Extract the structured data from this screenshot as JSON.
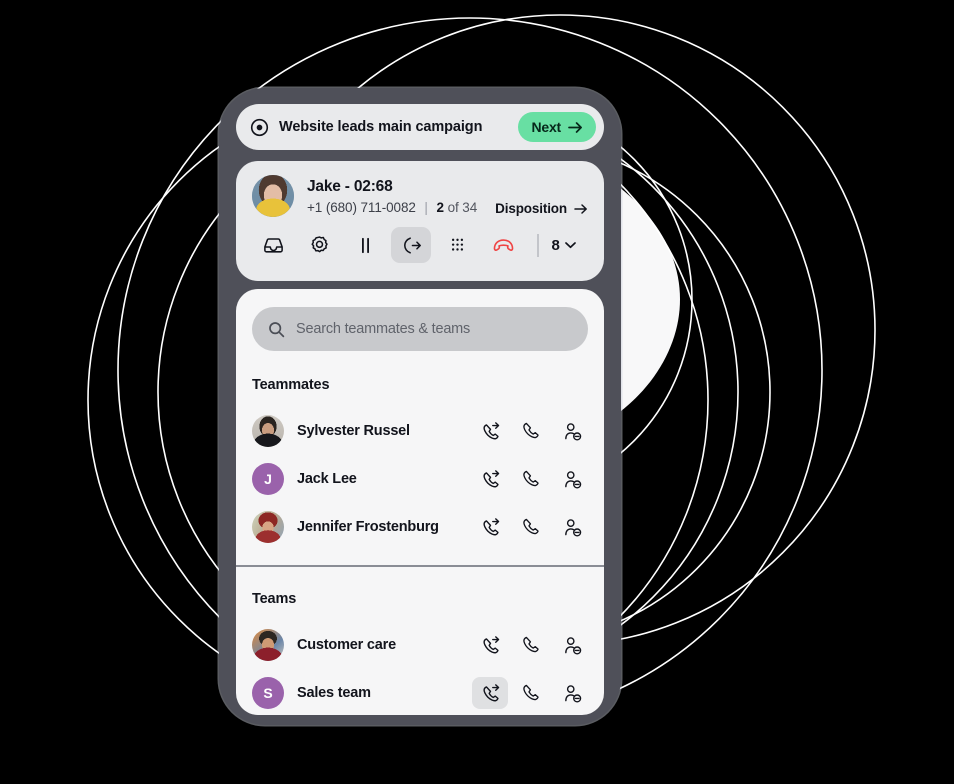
{
  "colors": {
    "background": "#000000",
    "phone_frame": "#4f5059",
    "card_surface": "#e9eaec",
    "panel_surface": "#f6f6f7",
    "accent_green": "#68dfa3",
    "hangup_red": "#ef4444",
    "avatar_purple": "#9a62ab",
    "search_field": "#c8c9cc",
    "text_primary": "#12141c",
    "decor_line": "#ffffff"
  },
  "campaign_bar": {
    "icon": "target-record-icon",
    "title": "Website leads main campaign",
    "next_label": "Next",
    "next_icon": "arrow-right-icon"
  },
  "call_card": {
    "avatar": "contact-photo",
    "contact_name": "Jake",
    "separator": "-",
    "duration": "02:68",
    "phone_number": "+1 (680) 711-0082",
    "pipe": "|",
    "position_index": "2",
    "position_of": "of 34",
    "disposition_label": "Disposition",
    "disposition_icon": "arrow-right-icon",
    "toolbar": [
      {
        "name": "inbox-icon",
        "label": "Inbox",
        "active": false
      },
      {
        "name": "gear-icon",
        "label": "Settings",
        "active": false
      },
      {
        "name": "pause-icon",
        "label": "Hold",
        "active": false
      },
      {
        "name": "phone-transfer-icon",
        "label": "Transfer",
        "active": true
      },
      {
        "name": "dialpad-icon",
        "label": "Keypad",
        "active": false
      },
      {
        "name": "hangup-icon",
        "label": "End call",
        "active": false
      }
    ],
    "count_value": "8",
    "count_icon": "chevron-down-icon"
  },
  "list_panel": {
    "search": {
      "icon": "search-icon",
      "placeholder": "Search teammates & teams",
      "value": ""
    },
    "teammates_title": "Teammates",
    "teammates": [
      {
        "name": "Sylvester Russel",
        "avatar_type": "photo",
        "avatar_class": "ph-syl",
        "initial": ""
      },
      {
        "name": "Jack Lee",
        "avatar_type": "initial",
        "avatar_class": "",
        "initial": "J"
      },
      {
        "name": "Jennifer Frostenburg",
        "avatar_type": "photo",
        "avatar_class": "ph-jen",
        "initial": ""
      }
    ],
    "teams_title": "Teams",
    "teams": [
      {
        "name": "Customer care",
        "avatar_type": "photo",
        "avatar_class": "ph-cust",
        "initial": ""
      },
      {
        "name": "Sales team",
        "avatar_type": "initial",
        "avatar_class": "",
        "initial": "S"
      }
    ],
    "row_actions": [
      {
        "name": "phone-forward-icon",
        "label": "Warm transfer"
      },
      {
        "name": "phone-icon",
        "label": "Call"
      },
      {
        "name": "person-add-icon",
        "label": "Add to call"
      }
    ],
    "active_row": "Sales team",
    "active_action": "phone-forward-icon"
  }
}
